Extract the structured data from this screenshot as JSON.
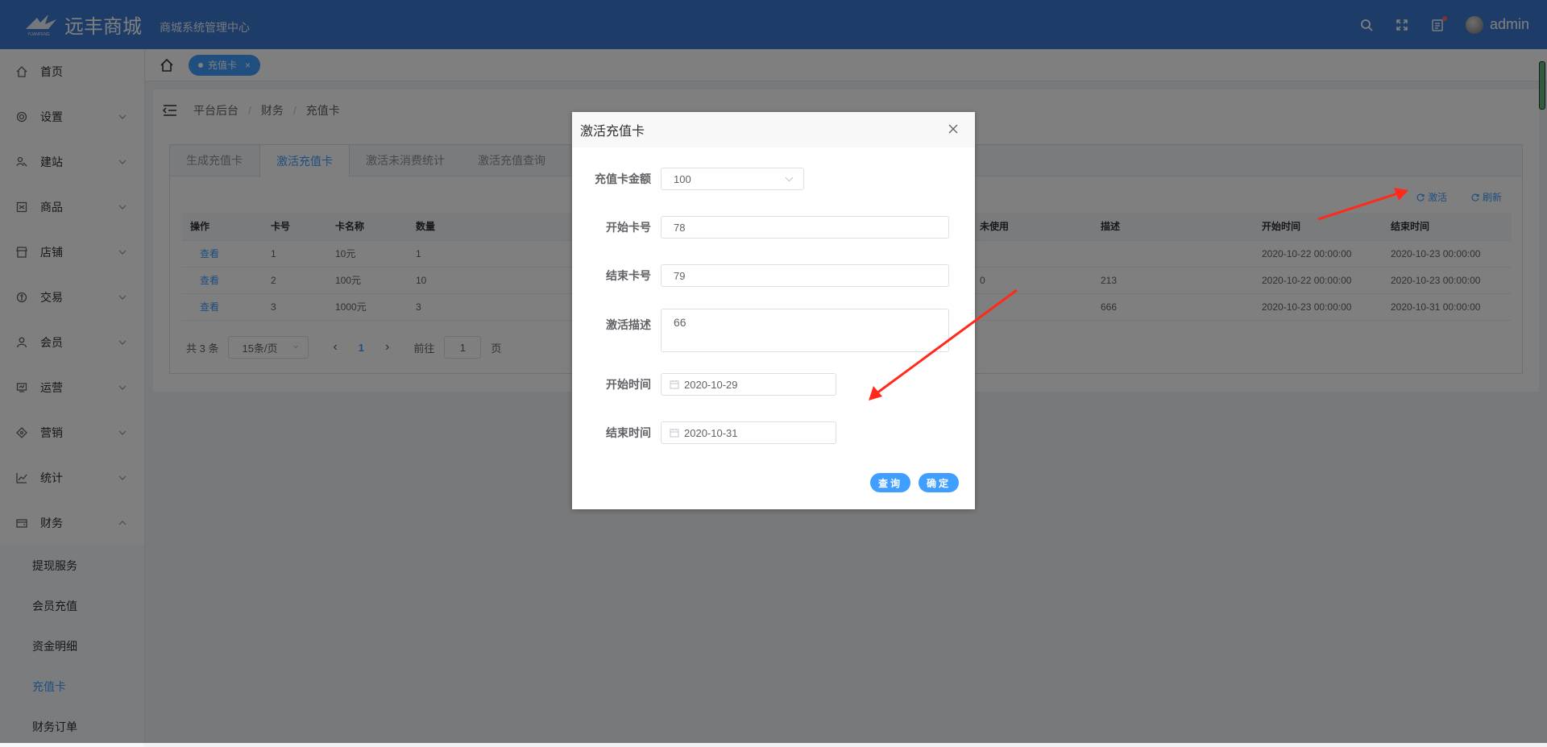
{
  "app": {
    "brand_name": "远丰商城",
    "brand_sub": "商城系统管理中心",
    "logo_text": "YUANFENG",
    "username": "admin"
  },
  "sidebar": {
    "items": [
      {
        "label": "首页",
        "icon": "home-icon",
        "expandable": false
      },
      {
        "label": "设置",
        "icon": "gear-icon",
        "expandable": true
      },
      {
        "label": "建站",
        "icon": "site-icon",
        "expandable": true
      },
      {
        "label": "商品",
        "icon": "product-icon",
        "expandable": true
      },
      {
        "label": "店铺",
        "icon": "store-icon",
        "expandable": true
      },
      {
        "label": "交易",
        "icon": "trade-icon",
        "expandable": true
      },
      {
        "label": "会员",
        "icon": "member-icon",
        "expandable": true
      },
      {
        "label": "运营",
        "icon": "operation-icon",
        "expandable": true
      },
      {
        "label": "营销",
        "icon": "marketing-icon",
        "expandable": true
      },
      {
        "label": "统计",
        "icon": "chart-icon",
        "expandable": true
      },
      {
        "label": "财务",
        "icon": "finance-icon",
        "expandable": true,
        "expanded": true
      }
    ],
    "finance_sub": [
      {
        "label": "提现服务"
      },
      {
        "label": "会员充值"
      },
      {
        "label": "资金明细"
      },
      {
        "label": "充值卡",
        "active": true
      },
      {
        "label": "财务订单"
      }
    ]
  },
  "tagbar": {
    "tag_label": "充值卡",
    "close": "×"
  },
  "breadcrumb": {
    "items": [
      "平台后台",
      "财务",
      "充值卡"
    ],
    "sep": "/"
  },
  "tabs": [
    "生成充值卡",
    "激活充值卡",
    "激活未消费统计",
    "激活充值查询"
  ],
  "toolbar": {
    "activate": "激活",
    "refresh": "刷新"
  },
  "table": {
    "headers": [
      "操作",
      "卡号",
      "卡名称",
      "数量",
      "未使用",
      "描述",
      "开始时间",
      "结束时间"
    ],
    "rows": [
      {
        "action": "查看",
        "card_no": "1",
        "name": "10元",
        "qty": "1",
        "unused": "",
        "desc": "",
        "start": "2020-10-22 00:00:00",
        "end": "2020-10-23 00:00:00"
      },
      {
        "action": "查看",
        "card_no": "2",
        "name": "100元",
        "qty": "10",
        "unused": "0",
        "desc": "213",
        "start": "2020-10-22 00:00:00",
        "end": "2020-10-23 00:00:00"
      },
      {
        "action": "查看",
        "card_no": "3",
        "name": "1000元",
        "qty": "3",
        "unused": "",
        "desc": "666",
        "start": "2020-10-23 00:00:00",
        "end": "2020-10-31 00:00:00"
      }
    ]
  },
  "pager": {
    "total": "共 3 条",
    "page_size": "15条/页",
    "prev": "‹",
    "current": "1",
    "next": "›",
    "goto": "前往",
    "goto_value": "1",
    "page_suffix": "页"
  },
  "dialog": {
    "title": "激活充值卡",
    "amount_label": "充值卡金额",
    "amount_value": "100",
    "start_no_label": "开始卡号",
    "start_no_value": "78",
    "end_no_label": "结束卡号",
    "end_no_value": "79",
    "desc_label": "激活描述",
    "desc_value": "66",
    "start_time_label": "开始时间",
    "start_time_value": "2020-10-29",
    "end_time_label": "结束时间",
    "end_time_value": "2020-10-31",
    "query_button": "查询",
    "confirm_button": "确定"
  },
  "colors": {
    "topbar": "#3b7bd0",
    "primary": "#409eff",
    "annotation": "#ff2a1a"
  }
}
